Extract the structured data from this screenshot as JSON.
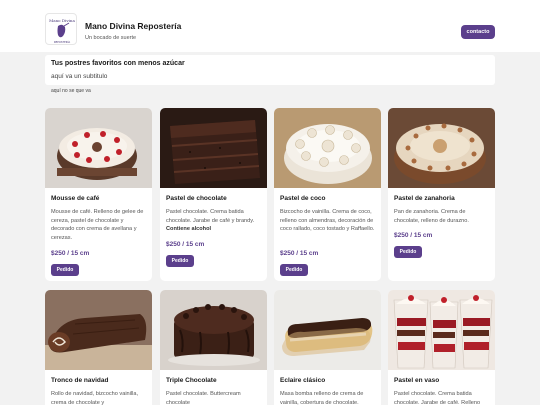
{
  "brand": {
    "name": "Mano Divina Repostería",
    "tagline": "Un bocado de suerte",
    "logo_text": "Mano Divina",
    "logo_subtext": "REPOSTERÍA"
  },
  "header": {
    "contact_label": "contacto"
  },
  "intro": {
    "title": "Tus postres favoritos con menos azúcar",
    "subtitle": "aquí va un subtitulo",
    "note": "aquí no se que va"
  },
  "colors": {
    "accent": "#5b3f8c",
    "background": "#f2f2f2",
    "card": "#ffffff"
  },
  "products": [
    {
      "name": "Mousse de café",
      "description": "Mousse de café. Relleno de gelee de cereza, pastel de chocolate y decorado con crema de avellana y cerezas.",
      "price": "$250 / 15 cm",
      "button": "Pedido",
      "image": "cake-coffee-mousse"
    },
    {
      "name": "Pastel de chocolate",
      "description": "Pastel chocolate. Crema batida chocolate. Jarabe de café y brandy.",
      "note": "Contiene alcohol",
      "price": "$250 / 15 cm",
      "button": "Pedido",
      "image": "cake-chocolate"
    },
    {
      "name": "Pastel de coco",
      "description": "Bizcocho de vainilla. Crema de coco, relleno con almendras, decoración de coco rallado, coco tostado y Raffaello.",
      "price": "$250 / 15 cm",
      "button": "Pedido",
      "image": "cake-coconut"
    },
    {
      "name": "Pastel de zanahoria",
      "description": "Pan de zanahoria. Crema de chocolate, relleno de durazno.",
      "price": "$250 / 15 cm",
      "button": "Pedido",
      "image": "cake-carrot"
    },
    {
      "name": "Tronco de navidad",
      "description": "Rollo de navidad, bizcocho vainilla, crema de chocolate y",
      "image": "cake-yule-log"
    },
    {
      "name": "Triple Chocolate",
      "description": "Pastel chocolate. Buttercream chocolate",
      "image": "cake-triple-chocolate"
    },
    {
      "name": "Eclaire clásico",
      "description": "Masa bomba relleno de crema de vainilla, cobertura de chocolate.",
      "image": "eclair"
    },
    {
      "name": "Pastel en vaso",
      "description": "Pastel chocolate. Crema batida chocolate. Jarabe de café. Relleno",
      "image": "cake-in-cup"
    }
  ]
}
